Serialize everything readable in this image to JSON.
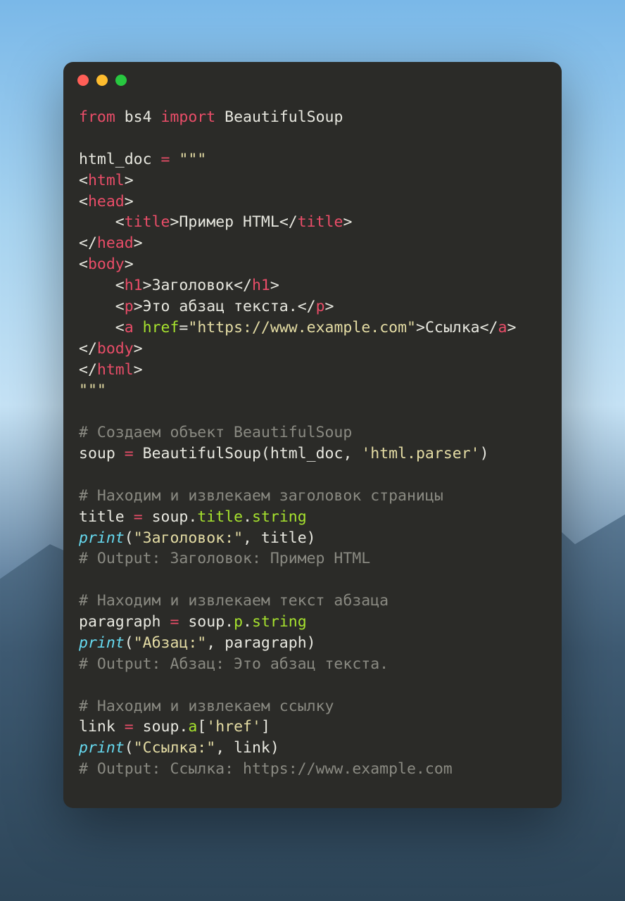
{
  "code": {
    "line1": {
      "kw_from": "from",
      "sp1": " ",
      "mod": "bs4",
      "sp2": " ",
      "kw_import": "import",
      "sp3": " ",
      "cls": "BeautifulSoup"
    },
    "line3": {
      "var": "html_doc",
      "sp": " ",
      "eq": "=",
      "sp2": " ",
      "triple": "\"\"\""
    },
    "line4": {
      "ang1": "<",
      "tag": "html",
      "ang2": ">"
    },
    "line5": {
      "ang1": "<",
      "tag": "head",
      "ang2": ">"
    },
    "line6": {
      "indent": "    ",
      "ang1": "<",
      "tag": "title",
      "ang2": ">",
      "text": "Пример HTML",
      "ang3": "</",
      "tag2": "title",
      "ang4": ">"
    },
    "line7": {
      "ang1": "</",
      "tag": "head",
      "ang2": ">"
    },
    "line8": {
      "ang1": "<",
      "tag": "body",
      "ang2": ">"
    },
    "line9": {
      "indent": "    ",
      "ang1": "<",
      "tag": "h1",
      "ang2": ">",
      "text": "Заголовок",
      "ang3": "</",
      "tag2": "h1",
      "ang4": ">"
    },
    "line10": {
      "indent": "    ",
      "ang1": "<",
      "tag": "p",
      "ang2": ">",
      "text": "Это абзац текста.",
      "ang3": "</",
      "tag2": "p",
      "ang4": ">"
    },
    "line11": {
      "indent": "    ",
      "ang1": "<",
      "tag": "a",
      "sp": " ",
      "attr": "href",
      "eq": "=",
      "val": "\"https://www.example.com\"",
      "ang2": ">",
      "text": "Ссылка",
      "ang3": "</",
      "tag2": "a",
      "ang4": ">"
    },
    "line12": {
      "ang1": "</",
      "tag": "body",
      "ang2": ">"
    },
    "line13": {
      "ang1": "</",
      "tag": "html",
      "ang2": ">"
    },
    "line14": {
      "triple": "\"\"\""
    },
    "line16": {
      "comment": "# Создаем объект BeautifulSoup"
    },
    "line17": {
      "var": "soup",
      "sp": " ",
      "eq": "=",
      "sp2": " ",
      "fn": "BeautifulSoup",
      "lp": "(",
      "arg1": "html_doc",
      "comma": ", ",
      "arg2": "'html.parser'",
      "rp": ")"
    },
    "line19": {
      "comment": "# Находим и извлекаем заголовок страницы"
    },
    "line20": {
      "var": "title",
      "sp": " ",
      "eq": "=",
      "sp2": " ",
      "obj": "soup",
      "dot1": ".",
      "p1": "title",
      "dot2": ".",
      "p2": "string"
    },
    "line21": {
      "fn": "print",
      "lp": "(",
      "s": "\"Заголовок:\"",
      "comma": ", ",
      "arg": "title",
      "rp": ")"
    },
    "line22": {
      "comment": "# Output: Заголовок: Пример HTML"
    },
    "line24": {
      "comment": "# Находим и извлекаем текст абзаца"
    },
    "line25": {
      "var": "paragraph",
      "sp": " ",
      "eq": "=",
      "sp2": " ",
      "obj": "soup",
      "dot1": ".",
      "p1": "p",
      "dot2": ".",
      "p2": "string"
    },
    "line26": {
      "fn": "print",
      "lp": "(",
      "s": "\"Абзац:\"",
      "comma": ", ",
      "arg": "paragraph",
      "rp": ")"
    },
    "line27": {
      "comment": "# Output: Абзац: Это абзац текста."
    },
    "line29": {
      "comment": "# Находим и извлекаем ссылку"
    },
    "line30": {
      "var": "link",
      "sp": " ",
      "eq": "=",
      "sp2": " ",
      "obj": "soup",
      "dot": ".",
      "p": "a",
      "lb": "[",
      "key": "'href'",
      "rb": "]"
    },
    "line31": {
      "fn": "print",
      "lp": "(",
      "s": "\"Ссылка:\"",
      "comma": ", ",
      "arg": "link",
      "rp": ")"
    },
    "line32": {
      "comment": "# Output: Ссылка: https://www.example.com"
    }
  }
}
